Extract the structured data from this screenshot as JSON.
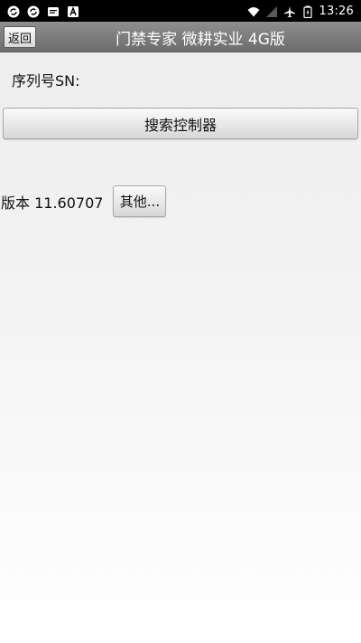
{
  "status_bar": {
    "time": "13:26",
    "left_icons": [
      "sync-icon",
      "sync-icon",
      "message-icon",
      "font-a-icon"
    ],
    "right_icons": [
      "wifi-icon",
      "signal-icon",
      "airplane-icon",
      "battery-icon"
    ]
  },
  "title_bar": {
    "back_label": "返回",
    "title": "门禁专家 微耕实业 4G版"
  },
  "main": {
    "sn_label": "序列号SN:",
    "search_button_label": "搜索控制器",
    "version_label": "版本 11.60707",
    "other_button_label": "其他..."
  },
  "colors": {
    "status_bar_bg": "#000000",
    "title_bar_bg": "#7b7b7b",
    "button_bg": "#e6e6e6",
    "text": "#111111",
    "title_text": "#ffffff"
  }
}
